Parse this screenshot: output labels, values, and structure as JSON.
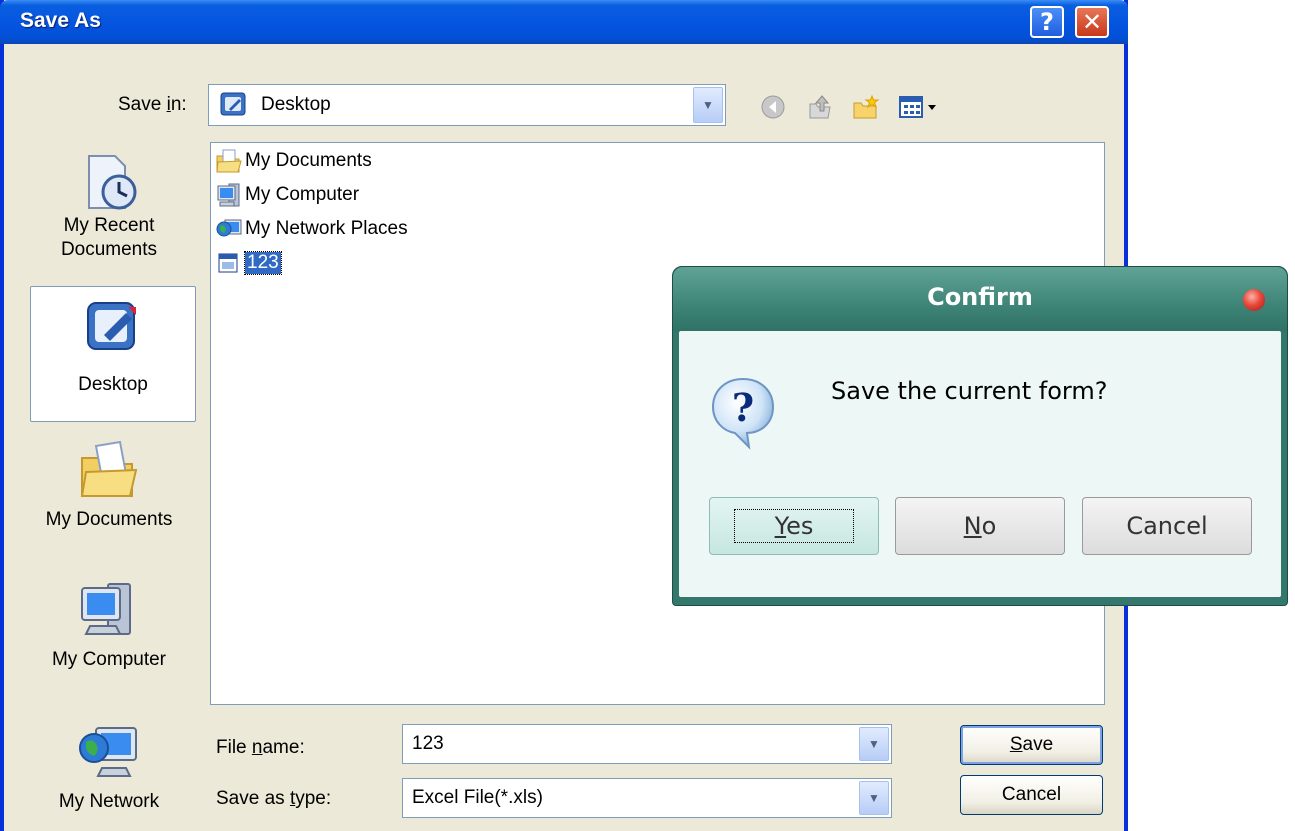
{
  "save_as": {
    "title": "Save As",
    "help_glyph": "?",
    "close_glyph": "✕",
    "save_in_label_pre": "Save ",
    "save_in_label_ul": "i",
    "save_in_label_post": "n:",
    "save_in_value": "Desktop",
    "toolbar_icons": [
      "back-icon",
      "up-folder-icon",
      "new-folder-icon",
      "views-menu-icon"
    ],
    "places": [
      {
        "line1": "My Recent",
        "line2": "Documents",
        "icon": "recent-documents-icon"
      },
      {
        "line1": "Desktop",
        "line2": "",
        "icon": "desktop-icon"
      },
      {
        "line1": "My Documents",
        "line2": "",
        "icon": "my-documents-icon"
      },
      {
        "line1": "My Computer",
        "line2": "",
        "icon": "my-computer-icon"
      },
      {
        "line1": "My Network",
        "line2": "",
        "icon": "my-network-icon"
      }
    ],
    "files": [
      {
        "name": "My Documents",
        "icon": "my-documents-icon"
      },
      {
        "name": "My Computer",
        "icon": "my-computer-icon"
      },
      {
        "name": "My Network Places",
        "icon": "network-places-icon"
      },
      {
        "name": "123",
        "icon": "excel-file-icon"
      }
    ],
    "file_name_label_pre": "File ",
    "file_name_label_ul": "n",
    "file_name_label_post": "ame:",
    "file_name_value": "123",
    "save_type_label_pre": "Save as ",
    "save_type_label_ul": "t",
    "save_type_label_post": "ype:",
    "save_type_value": "Excel File(*.xls)",
    "save_button_ul": "S",
    "save_button_rest": "ave",
    "cancel_button": "Cancel"
  },
  "confirm": {
    "title": "Confirm",
    "message": "Save the current form?",
    "yes_ul": "Y",
    "yes_rest": "es",
    "no_ul": "N",
    "no_rest": "o",
    "cancel": "Cancel"
  },
  "colors": {
    "xp_title_blue": "#0555e0",
    "confirm_teal": "#34786d",
    "selection_blue": "#316ac5"
  }
}
